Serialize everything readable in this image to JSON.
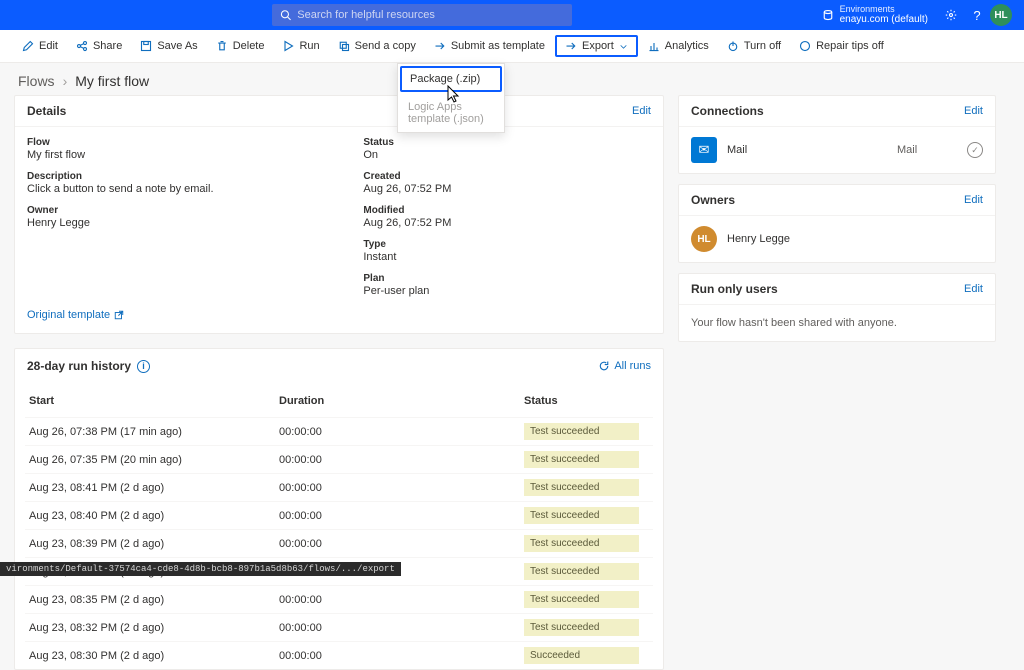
{
  "topbar": {
    "search_placeholder": "Search for helpful resources",
    "env_label": "Environments",
    "env_name": "enayu.com (default)",
    "avatar_initials": "HL"
  },
  "cmds": {
    "edit": "Edit",
    "share": "Share",
    "saveas": "Save As",
    "delete": "Delete",
    "run": "Run",
    "sendcopy": "Send a copy",
    "submit": "Submit as template",
    "export": "Export",
    "analytics": "Analytics",
    "turnoff": "Turn off",
    "repair": "Repair tips off"
  },
  "export_menu": {
    "zip": "Package (.zip)",
    "json": "Logic Apps template (.json)"
  },
  "crumb": {
    "parent": "Flows",
    "current": "My first flow"
  },
  "details": {
    "title": "Details",
    "edit": "Edit",
    "flow_l": "Flow",
    "flow_v": "My first flow",
    "desc_l": "Description",
    "desc_v": "Click a button to send a note by email.",
    "owner_l": "Owner",
    "owner_v": "Henry Legge",
    "status_l": "Status",
    "status_v": "On",
    "created_l": "Created",
    "created_v": "Aug 26, 07:52 PM",
    "modified_l": "Modified",
    "modified_v": "Aug 26, 07:52 PM",
    "type_l": "Type",
    "type_v": "Instant",
    "plan_l": "Plan",
    "plan_v": "Per-user plan",
    "orig_tpl": "Original template"
  },
  "runhist": {
    "title": "28-day run history",
    "all_runs": "All runs",
    "cols": {
      "start": "Start",
      "dur": "Duration",
      "status": "Status"
    },
    "rows": [
      {
        "start": "Aug 26, 07:38 PM (17 min ago)",
        "dur": "00:00:00",
        "status": "Test succeeded"
      },
      {
        "start": "Aug 26, 07:35 PM (20 min ago)",
        "dur": "00:00:00",
        "status": "Test succeeded"
      },
      {
        "start": "Aug 23, 08:41 PM (2 d ago)",
        "dur": "00:00:00",
        "status": "Test succeeded"
      },
      {
        "start": "Aug 23, 08:40 PM (2 d ago)",
        "dur": "00:00:00",
        "status": "Test succeeded"
      },
      {
        "start": "Aug 23, 08:39 PM (2 d ago)",
        "dur": "00:00:00",
        "status": "Test succeeded"
      },
      {
        "start": "Aug 23, 08:36 PM (2 d ago)",
        "dur": "00:00:00",
        "status": "Test succeeded"
      },
      {
        "start": "Aug 23, 08:35 PM (2 d ago)",
        "dur": "00:00:00",
        "status": "Test succeeded"
      },
      {
        "start": "Aug 23, 08:32 PM (2 d ago)",
        "dur": "00:00:00",
        "status": "Test succeeded"
      },
      {
        "start": "Aug 23, 08:30 PM (2 d ago)",
        "dur": "00:00:00",
        "status": "Succeeded"
      }
    ]
  },
  "connections": {
    "title": "Connections",
    "edit": "Edit",
    "name": "Mail",
    "role": "Mail"
  },
  "owners": {
    "title": "Owners",
    "edit": "Edit",
    "initials": "HL",
    "name": "Henry Legge"
  },
  "runonly": {
    "title": "Run only users",
    "edit": "Edit",
    "msg": "Your flow hasn't been shared with anyone."
  },
  "status_path": "vironments/Default-37574ca4-cde8-4d8b-bcb8-897b1a5d8b63/flows/.../export"
}
